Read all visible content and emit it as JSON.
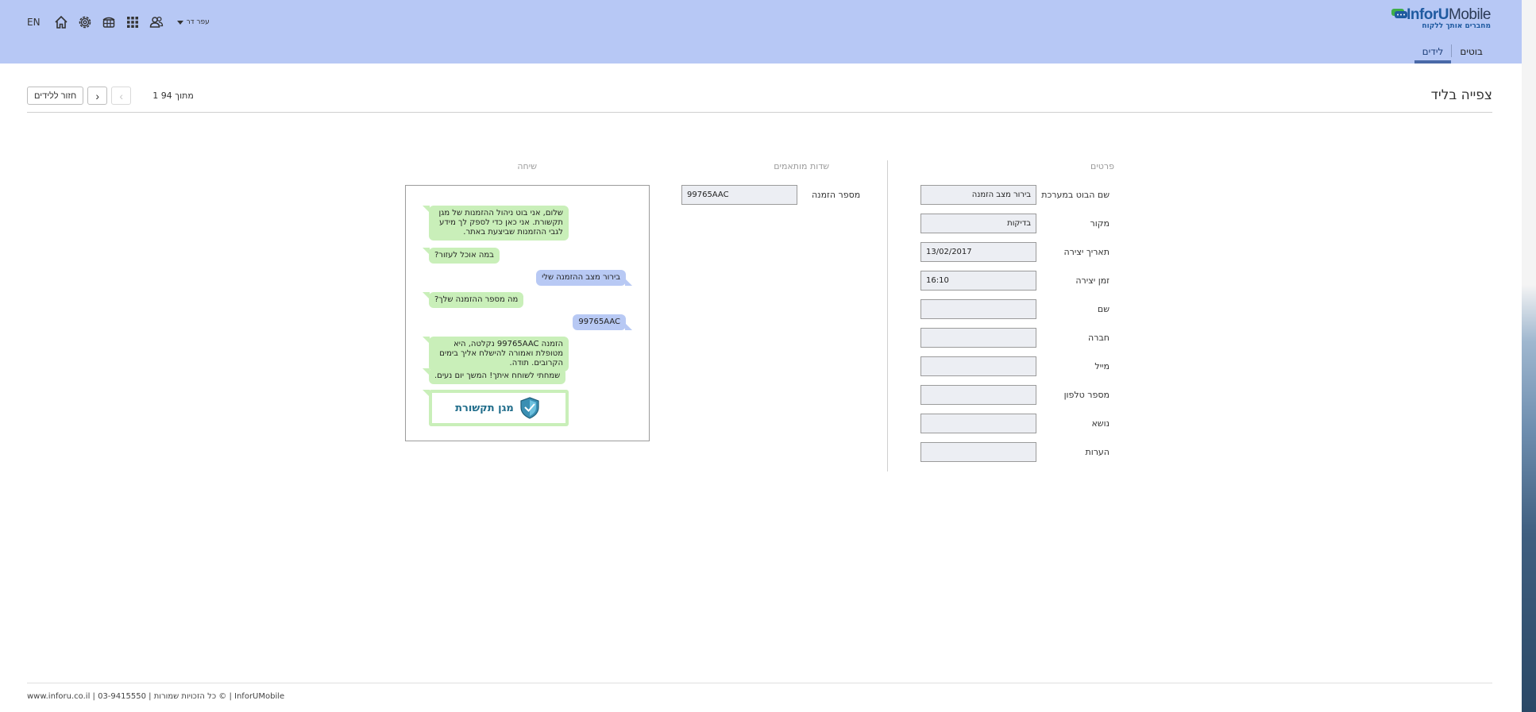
{
  "header": {
    "logo_part1": "Infor",
    "logo_part2": "U",
    "logo_part3": "Mobile",
    "logo_tagline": "מחברים אותך ללקוח",
    "nav": [
      {
        "label": "בוטים"
      },
      {
        "label": "לידים"
      }
    ],
    "lang": "EN",
    "user_name": "עפר דר",
    "icons": [
      "home-icon",
      "settings-icon",
      "store-icon",
      "apps-grid-icon",
      "users-icon"
    ]
  },
  "page": {
    "title": "צפייה בליד",
    "back_button": "חזור ללידים",
    "pager_text": "1 מתוך 94"
  },
  "details": {
    "header": "פרטים",
    "fields": [
      {
        "label": "שם הבוט במערכת",
        "value": "בירור מצב הזמנה"
      },
      {
        "label": "מקור",
        "value": "בדיקות"
      },
      {
        "label": "תאריך יצירה",
        "value": "13/02/2017"
      },
      {
        "label": "זמן יצירה",
        "value": "16:10"
      },
      {
        "label": "שם",
        "value": ""
      },
      {
        "label": "חברה",
        "value": ""
      },
      {
        "label": "מייל",
        "value": ""
      },
      {
        "label": "מספר טלפון",
        "value": ""
      },
      {
        "label": "נושא",
        "value": ""
      },
      {
        "label": "הערות",
        "value": ""
      }
    ]
  },
  "custom_fields": {
    "header": "שדות מותאמים",
    "fields": [
      {
        "label": "מספר הזמנה",
        "value": "99765AAC"
      }
    ]
  },
  "conversation": {
    "header": "שיחה",
    "messages": [
      {
        "from": "bot",
        "text": "שלום, אני בוט ניהול ההזמנות של מגן תקשורת. אני כאן כדי לספק לך מידע לגבי ההזמנות שביצעת באתר."
      },
      {
        "from": "bot",
        "text": "במה אוכל לעזור?"
      },
      {
        "from": "user",
        "text": "בירור מצב ההזמנה שלי"
      },
      {
        "from": "bot",
        "text": "מה מספר ההזמנה שלך?"
      },
      {
        "from": "user",
        "text": "99765AAC"
      },
      {
        "from": "bot",
        "text": "הזמנה 99765AAC נקלטה, היא מטופלת ואמורה להישלח אליך בימים הקרובים. תודה."
      },
      {
        "from": "bot",
        "text": "שמחתי לשוחח איתך! המשך יום נעים."
      }
    ],
    "logo_message_text": "מגן תקשורת"
  },
  "footer": {
    "text": "www.inforu.co.il | 03-9415550 | כל הזכויות שמורות © | InforUMobile"
  },
  "colors": {
    "header_bg": "#b7c8f5",
    "bot_bubble": "#c9efb9",
    "user_bubble": "#b8c9f4",
    "brand_blue": "#1e5aa0"
  }
}
